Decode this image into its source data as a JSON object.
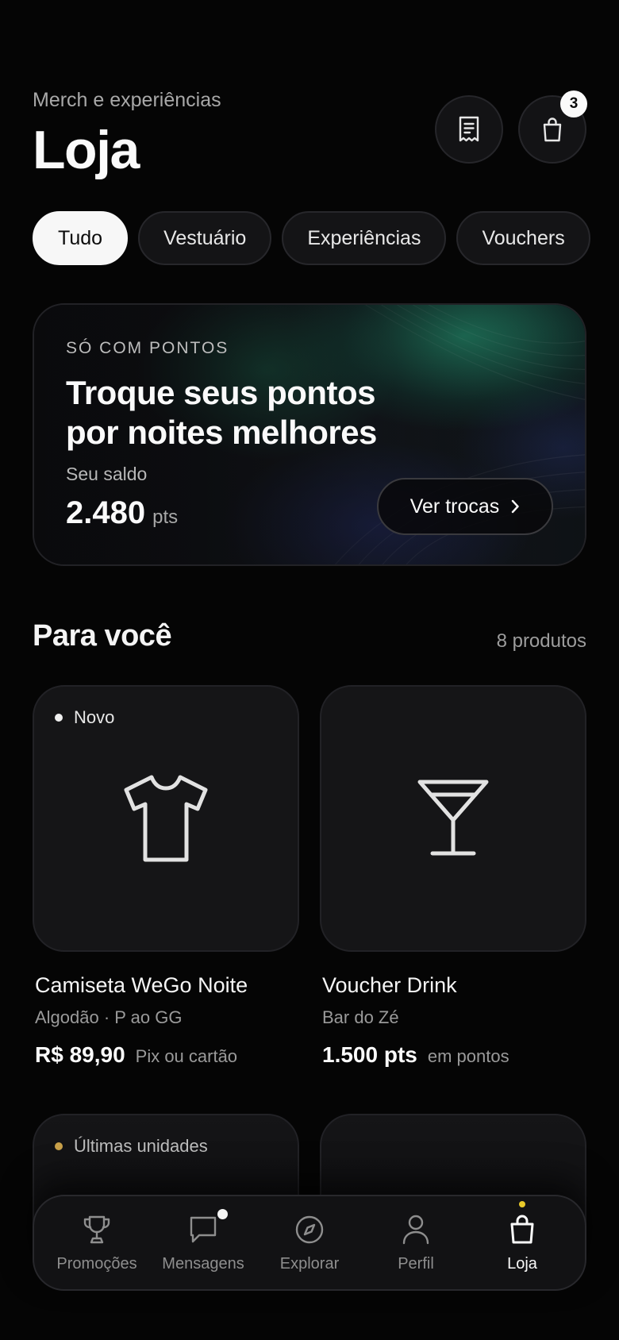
{
  "header": {
    "subtitle": "Merch e experiências",
    "title": "Loja",
    "cart_count": "3"
  },
  "tabs": [
    {
      "label": "Tudo",
      "active": true
    },
    {
      "label": "Vestuário",
      "active": false
    },
    {
      "label": "Experiências",
      "active": false
    },
    {
      "label": "Vouchers",
      "active": false
    }
  ],
  "promo": {
    "eyebrow": "SÓ COM PONTOS",
    "title": "Troque seus pontos por noites melhores",
    "balance_label": "Seu saldo",
    "balance_value": "2.480",
    "balance_unit": "pts",
    "button_label": "Ver trocas"
  },
  "section": {
    "title": "Para você",
    "count": "8 produtos"
  },
  "products": [
    {
      "tag": "Novo",
      "icon": "tshirt-icon",
      "name": "Camiseta WeGo Noite",
      "detail": "Algodão · P ao GG",
      "price": "R$ 89,90",
      "price_note": "Pix ou cartão"
    },
    {
      "tag": "",
      "icon": "cocktail-icon",
      "name": "Voucher Drink",
      "detail": "Bar do Zé",
      "price": "1.500 pts",
      "price_note": "em pontos"
    },
    {
      "tag": "Últimas unidades"
    }
  ],
  "nav": {
    "items": [
      {
        "label": "Promoções",
        "icon": "trophy-icon"
      },
      {
        "label": "Mensagens",
        "icon": "chat-icon"
      },
      {
        "label": "Explorar",
        "icon": "compass-icon"
      },
      {
        "label": "Perfil",
        "icon": "user-icon"
      },
      {
        "label": "Loja",
        "icon": "bag-icon",
        "active": true
      }
    ]
  },
  "colors": {
    "background": "#050505",
    "accent_dot": "#e9c92a",
    "low_stock_dot": "#c9a14a"
  }
}
